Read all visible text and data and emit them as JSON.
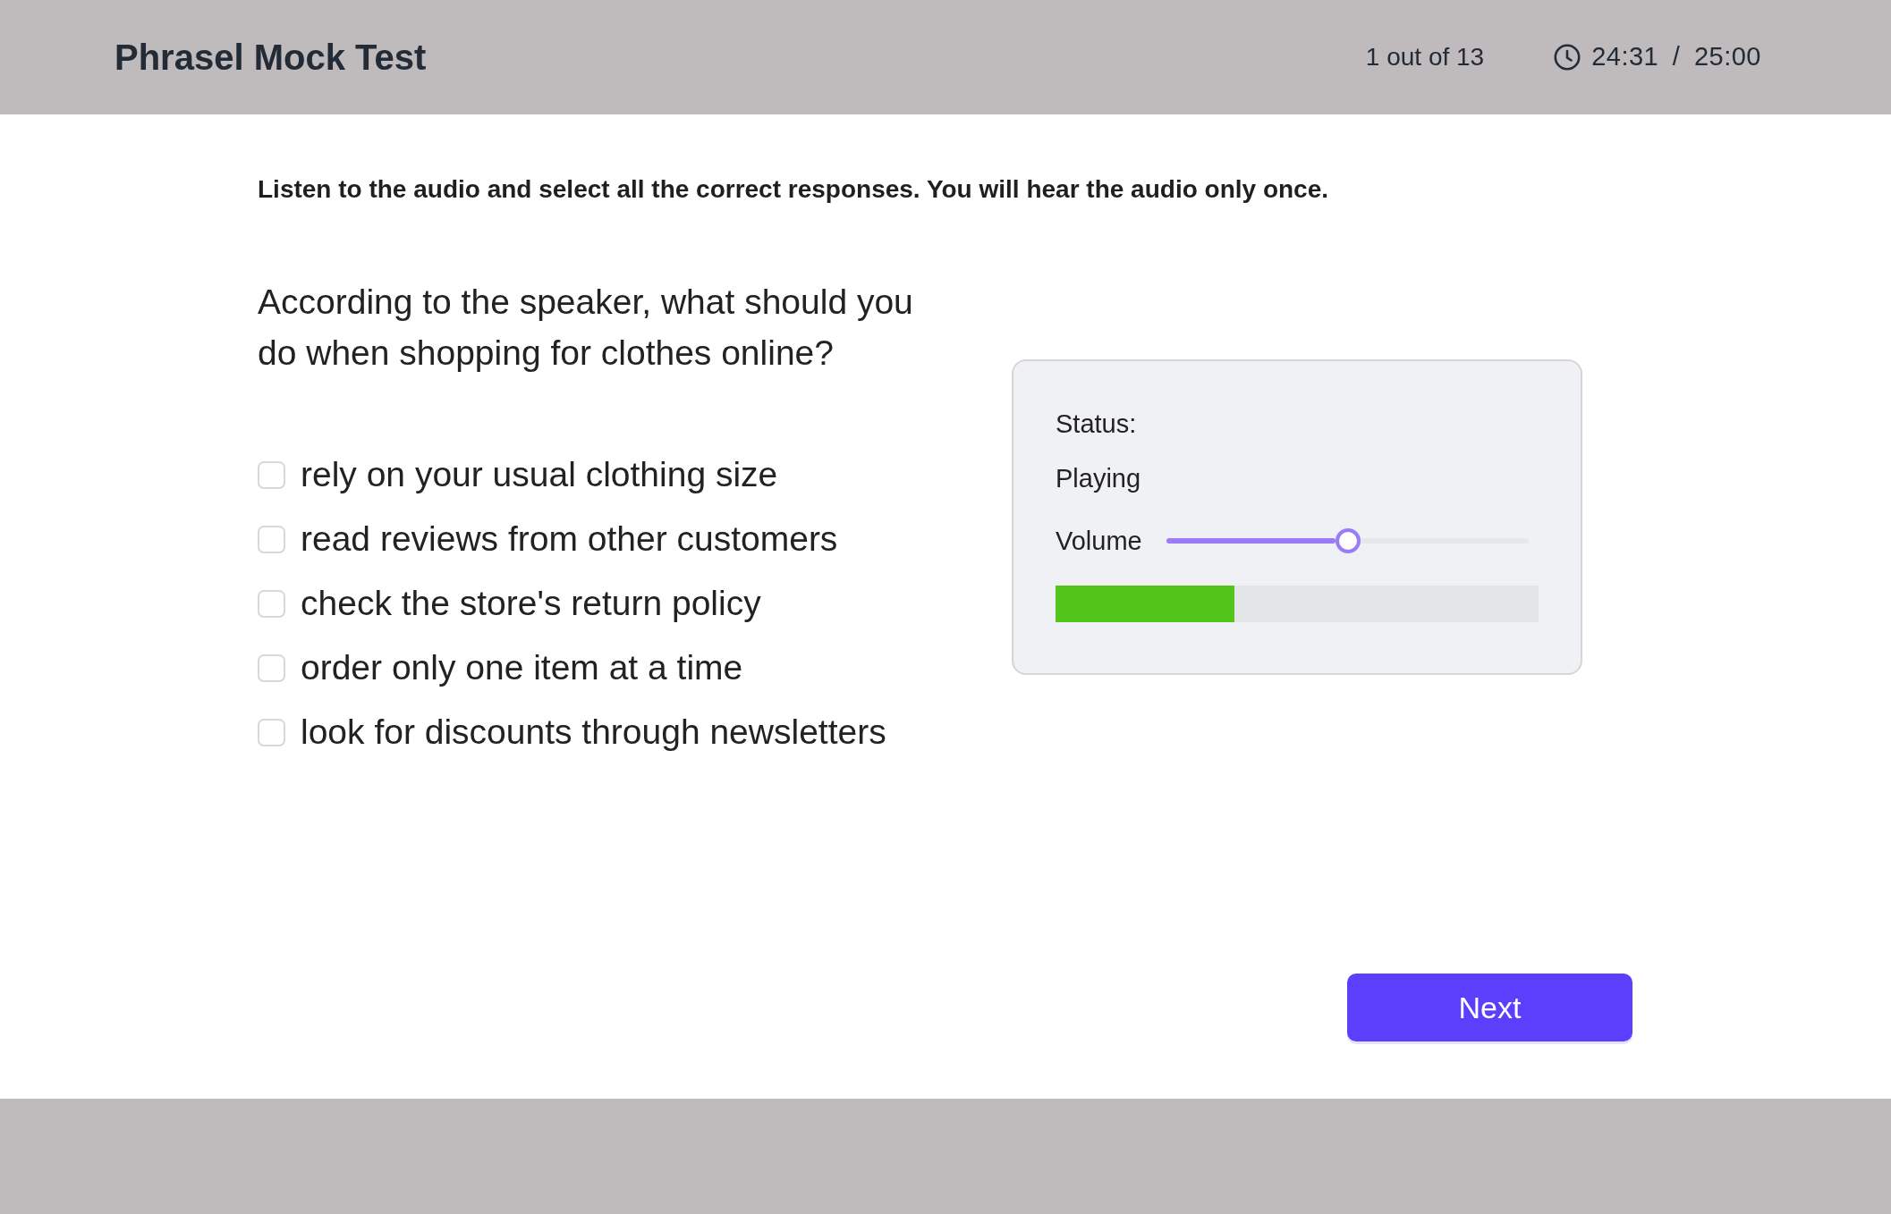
{
  "header": {
    "title": "Phrasel Mock Test",
    "progress": "1 out of 13",
    "timer": "24:31 / 25:00"
  },
  "instruction": "Listen to the audio and select all the correct responses. You will hear the audio only once.",
  "question": {
    "text": "According to the speaker, what should you do when shopping for clothes online?",
    "options": [
      {
        "label": "rely on your usual clothing size",
        "checked": false
      },
      {
        "label": "read reviews from other customers",
        "checked": false
      },
      {
        "label": "check the store's return policy",
        "checked": false
      },
      {
        "label": "order only one item at a time",
        "checked": false
      },
      {
        "label": "look for discounts through newsletters",
        "checked": false
      }
    ]
  },
  "audio_player": {
    "status_label": "Status:",
    "status": "Playing",
    "volume": {
      "label": "Volume",
      "level": 0.5
    },
    "progress": {
      "level": 0.37
    }
  },
  "buttons": [
    {
      "label": "Next"
    }
  ]
}
